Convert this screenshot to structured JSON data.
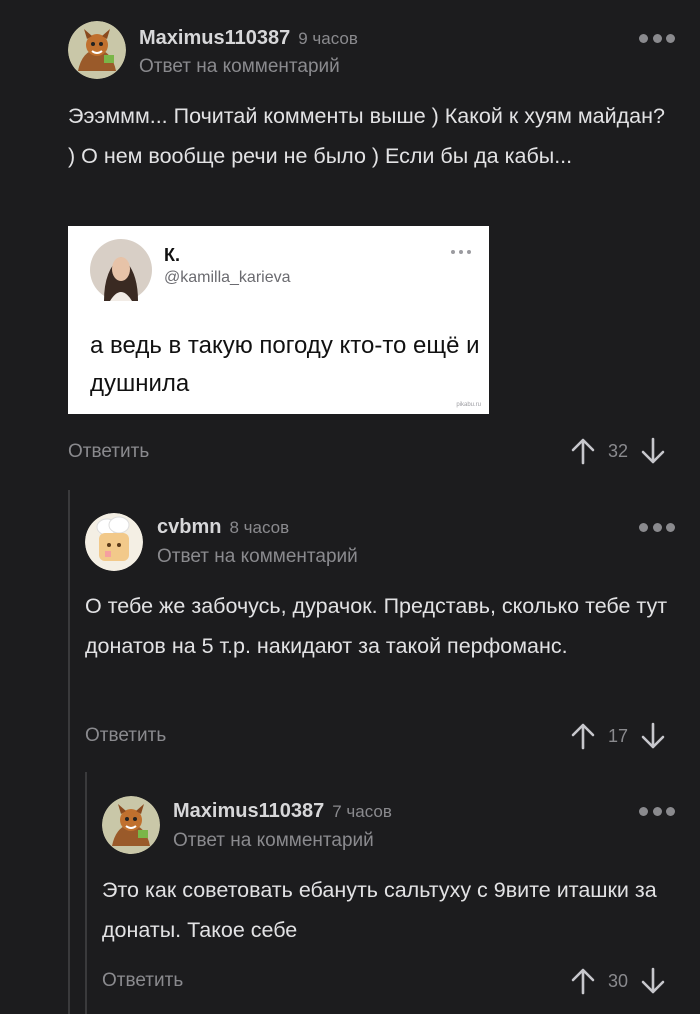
{
  "comments": [
    {
      "author": "Maximus110387",
      "time": "9 часов",
      "reply_note": "Ответ на комментарий",
      "text": "Эээммм... Почитай комменты выше ) Какой к хуям майдан? ) О нем вообще речи не было ) Если бы да кабы...",
      "reply_label": "Ответить",
      "votes": "32",
      "avatar_icon": "fox-mascot-avatar"
    },
    {
      "author": "cvbmn",
      "time": "8 часов",
      "reply_note": "Ответ на комментарий",
      "text": "О тебе же забочусь, дурачок. Представь, сколько тебе тут донатов на 5 т.р. накидают за такой перфоманс.",
      "reply_label": "Ответить",
      "votes": "17",
      "avatar_icon": "chef-bread-avatar"
    },
    {
      "author": "Maximus110387",
      "time": "7 часов",
      "reply_note": "Ответ на комментарий",
      "text": "Это как советовать ебануть сальтуху с 9вите иташки за донаты. Такое себе",
      "reply_label": "Ответить",
      "votes": "30",
      "avatar_icon": "fox-mascot-avatar"
    }
  ],
  "embed": {
    "name": "К.",
    "handle": "@kamilla_karieva",
    "text": "а ведь в такую погоду кто-то ещё и душнила",
    "watermark": "pikabu.ru"
  },
  "colors": {
    "background": "#1c1c1e",
    "text": "#e2e2e4",
    "muted": "#8a8a8e",
    "thread_line": "#3a3a3c"
  }
}
